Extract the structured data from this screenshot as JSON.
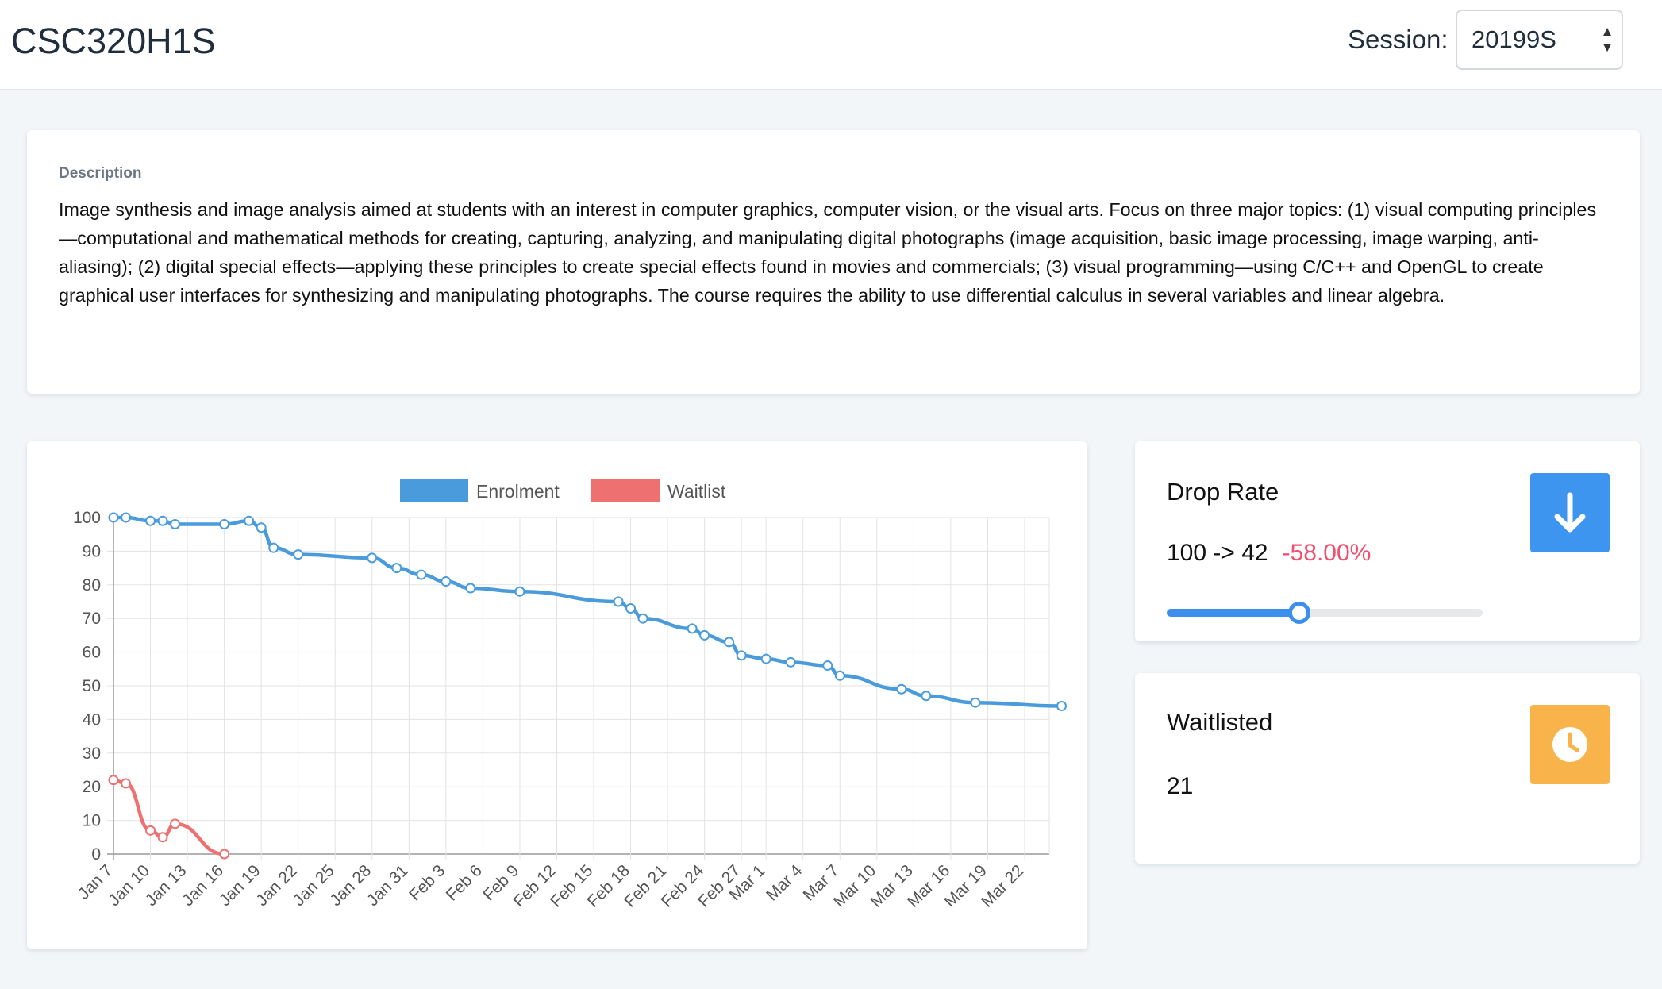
{
  "header": {
    "course_code": "CSC320H1S",
    "session_label": "Session:",
    "session_value": "20199S"
  },
  "description": {
    "heading": "Description",
    "text": "Image synthesis and image analysis aimed at students with an interest in computer graphics, computer vision, or the visual arts. Focus on three major topics: (1) visual computing principles—computational and mathematical methods for creating, capturing, analyzing, and manipulating digital photographs (image acquisition, basic image processing, image warping, anti-aliasing); (2) digital special effects—applying these principles to create special effects found in movies and commercials; (3) visual programming—using C/C++ and OpenGL to create graphical user interfaces for synthesizing and manipulating photographs. The course requires the ability to use differential calculus in several variables and linear algebra."
  },
  "drop_rate": {
    "title": "Drop Rate",
    "values_text": "100 -> 42",
    "change_text": "-58.00%",
    "slider_fraction": 0.42,
    "icon": "arrow-down-icon",
    "color": "#3d95f0"
  },
  "waitlisted": {
    "title": "Waitlisted",
    "value": "21",
    "icon": "clock-icon",
    "color": "#f8b44b"
  },
  "chart_data": {
    "type": "line",
    "title": "",
    "xlabel": "",
    "ylabel": "",
    "ylim": [
      0,
      100
    ],
    "y_ticks": [
      0,
      10,
      20,
      30,
      40,
      50,
      60,
      70,
      80,
      90,
      100
    ],
    "x_tick_labels": [
      "Jan 7",
      "Jan 10",
      "Jan 13",
      "Jan 16",
      "Jan 19",
      "Jan 22",
      "Jan 25",
      "Jan 28",
      "Jan 31",
      "Feb 3",
      "Feb 6",
      "Feb 9",
      "Feb 12",
      "Feb 15",
      "Feb 18",
      "Feb 21",
      "Feb 24",
      "Feb 27",
      "Mar 1",
      "Mar 4",
      "Mar 7",
      "Mar 10",
      "Mar 13",
      "Mar 16",
      "Mar 19",
      "Mar 22"
    ],
    "x_start": "Jan 7",
    "x_end": "Mar 24",
    "grid": true,
    "legend_position": "top",
    "series": [
      {
        "name": "Enrolment",
        "color": "#4a9bdc",
        "points": [
          [
            "Jan 7",
            100
          ],
          [
            "Jan 8",
            100
          ],
          [
            "Jan 10",
            99
          ],
          [
            "Jan 11",
            99
          ],
          [
            "Jan 12",
            98
          ],
          [
            "Jan 16",
            98
          ],
          [
            "Jan 18",
            99
          ],
          [
            "Jan 19",
            97
          ],
          [
            "Jan 20",
            91
          ],
          [
            "Jan 22",
            89
          ],
          [
            "Jan 28",
            88
          ],
          [
            "Jan 30",
            85
          ],
          [
            "Feb 1",
            83
          ],
          [
            "Feb 3",
            81
          ],
          [
            "Feb 5",
            79
          ],
          [
            "Feb 9",
            78
          ],
          [
            "Feb 17",
            75
          ],
          [
            "Feb 18",
            73
          ],
          [
            "Feb 19",
            70
          ],
          [
            "Feb 23",
            67
          ],
          [
            "Feb 24",
            65
          ],
          [
            "Feb 26",
            63
          ],
          [
            "Feb 27",
            59
          ],
          [
            "Mar 1",
            58
          ],
          [
            "Mar 3",
            57
          ],
          [
            "Mar 6",
            56
          ],
          [
            "Mar 7",
            53
          ],
          [
            "Mar 12",
            49
          ],
          [
            "Mar 14",
            47
          ],
          [
            "Mar 18",
            45
          ],
          [
            "Mar 25",
            44
          ]
        ]
      },
      {
        "name": "Waitlist",
        "color": "#ee7070",
        "points": [
          [
            "Jan 7",
            22
          ],
          [
            "Jan 8",
            21
          ],
          [
            "Jan 10",
            7
          ],
          [
            "Jan 11",
            5
          ],
          [
            "Jan 12",
            9
          ],
          [
            "Jan 16",
            0
          ]
        ]
      }
    ]
  }
}
